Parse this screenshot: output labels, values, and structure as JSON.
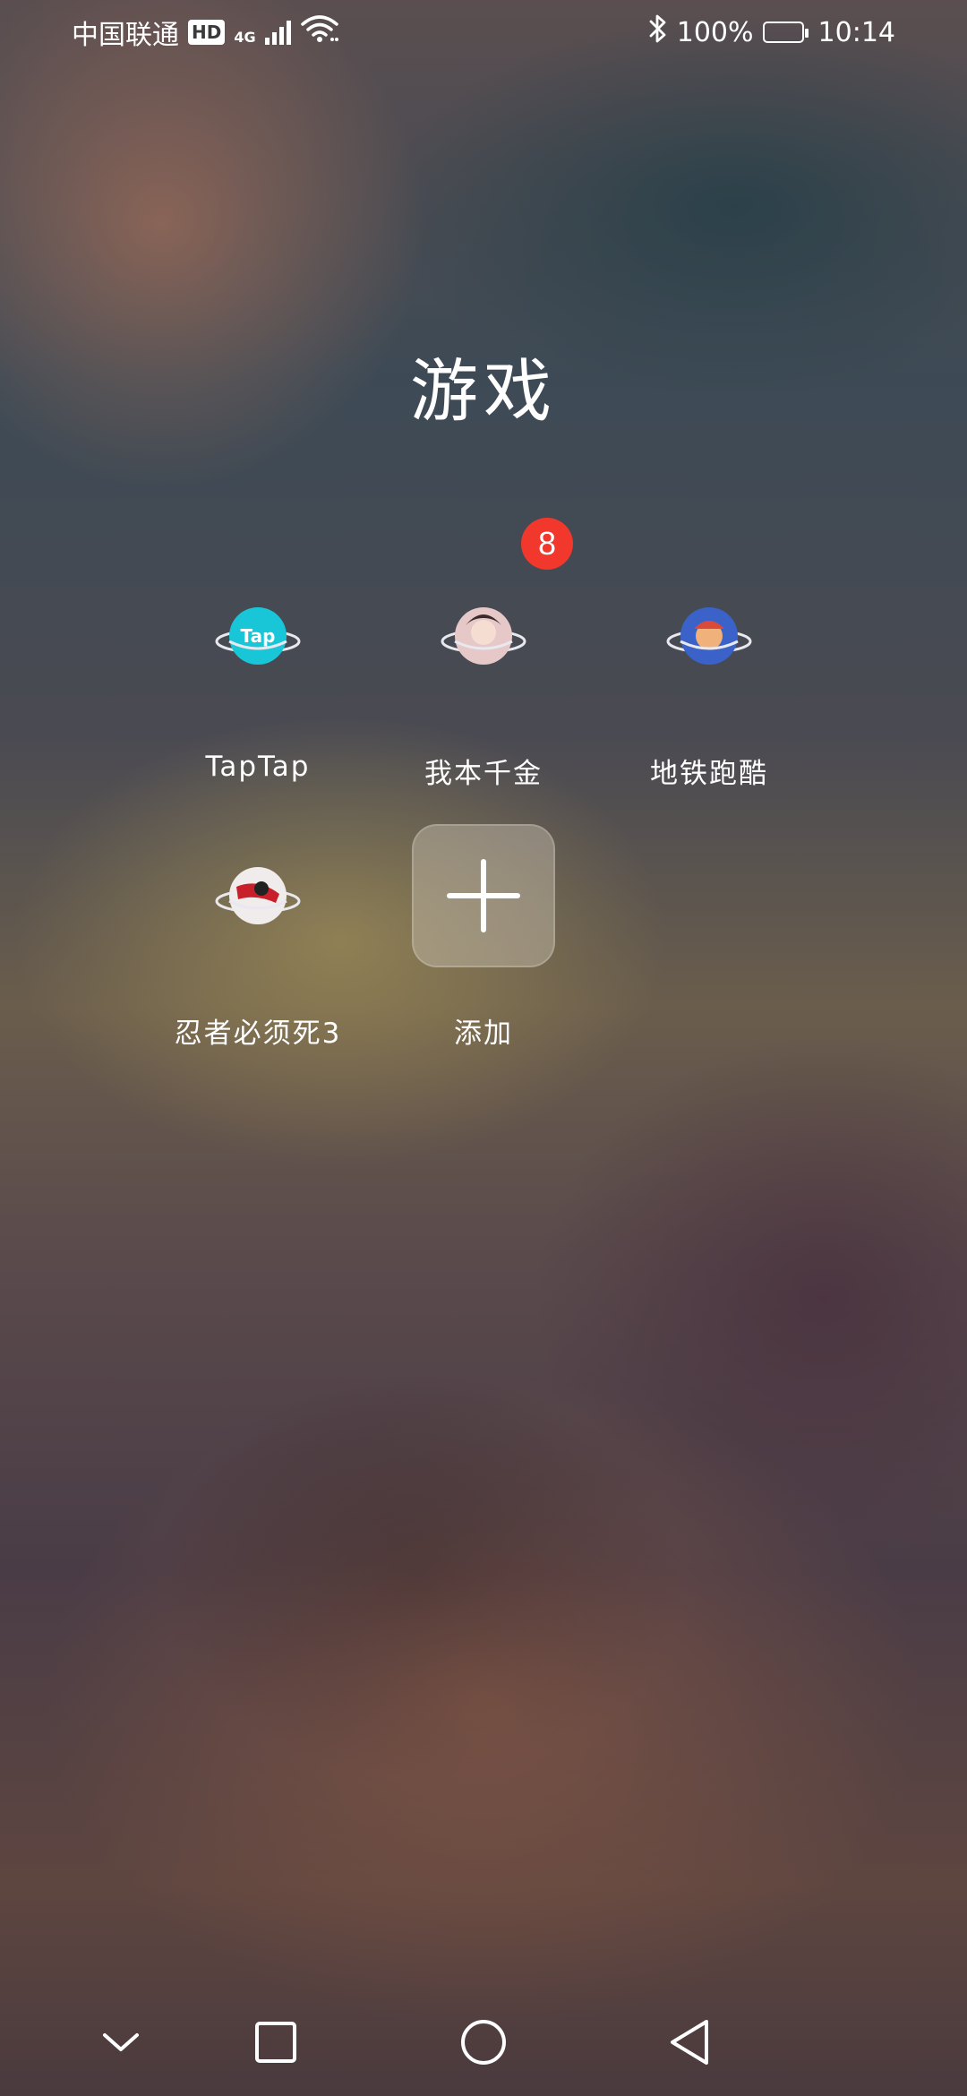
{
  "status_bar": {
    "carrier": "中国联通",
    "hd": "HD",
    "network_type": "4G",
    "battery_percent": "100%",
    "time": "10:14",
    "icons": [
      "hd-icon",
      "signal-icon",
      "wifi-icon",
      "bluetooth-icon",
      "battery-charging-icon"
    ]
  },
  "folder": {
    "title": "游戏",
    "apps": [
      {
        "label": "TapTap",
        "icon": "taptap-icon",
        "badge": ""
      },
      {
        "label": "我本千金",
        "icon": "wobenqianjin-icon",
        "badge": "8"
      },
      {
        "label": "地铁跑酷",
        "icon": "subway-surfers-icon",
        "badge": ""
      },
      {
        "label": "忍者必须死3",
        "icon": "ninja-must-die-3-icon",
        "badge": ""
      }
    ],
    "add_label": "添加"
  },
  "nav_bar": {
    "buttons": [
      "collapse-icon",
      "recents-icon",
      "home-icon",
      "back-icon"
    ]
  }
}
